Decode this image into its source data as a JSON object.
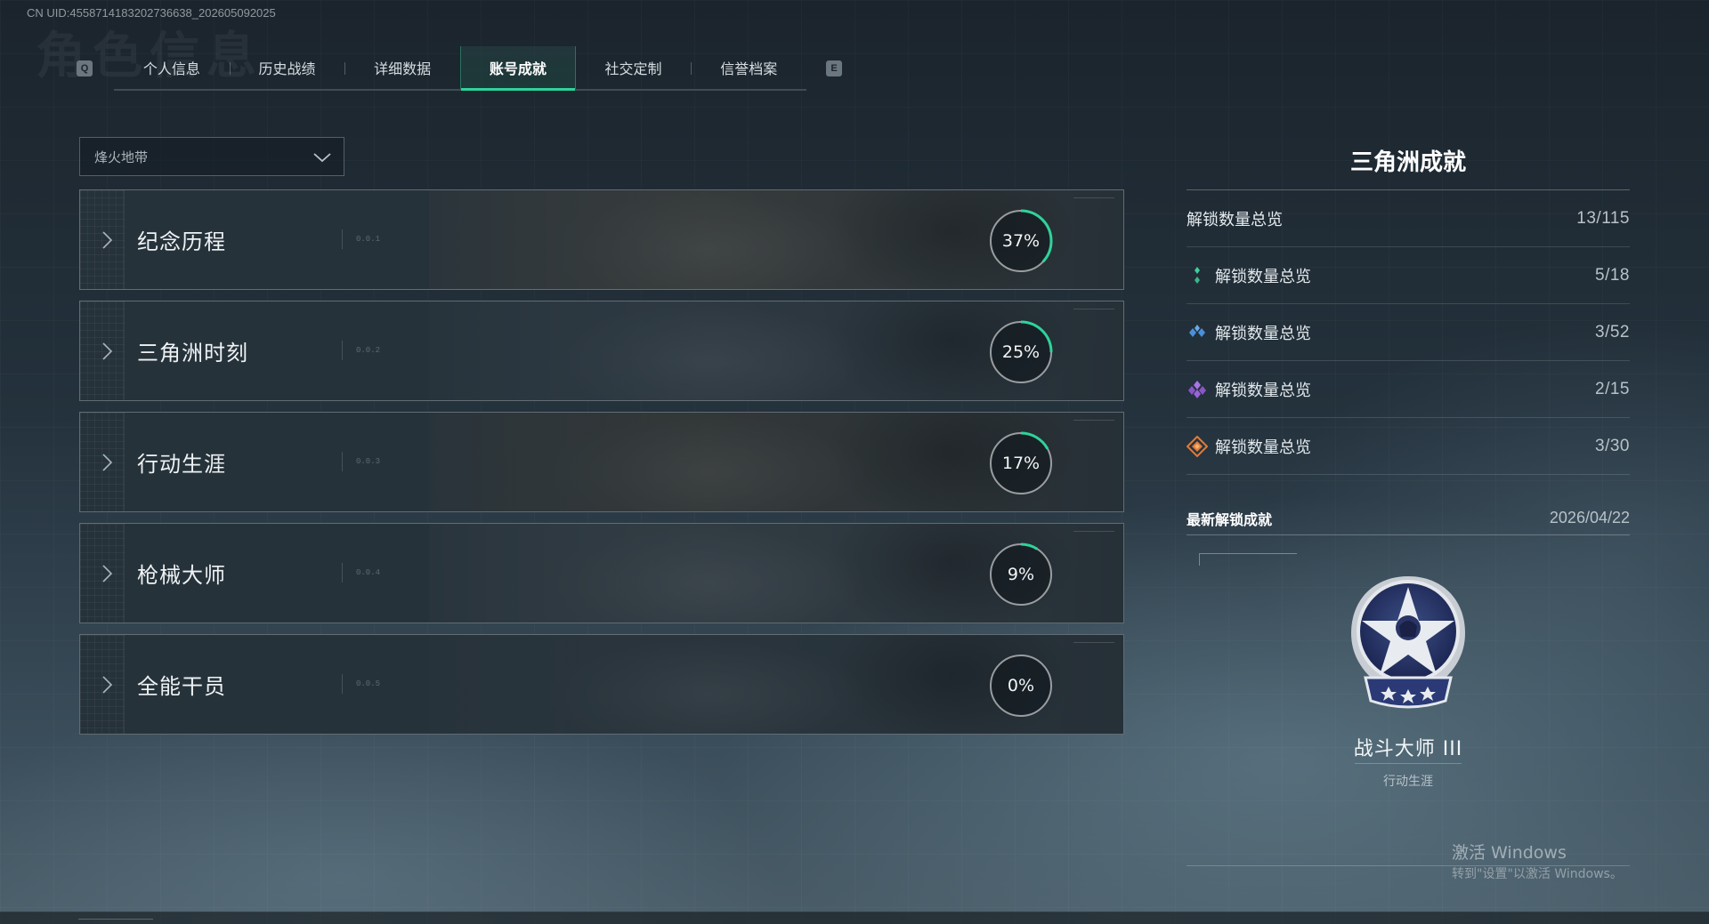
{
  "uid_text": "CN UID:4558714183202736638_202605092025",
  "watermark_title": "角色信息",
  "tabs": {
    "key_left": "Q",
    "key_right": "E",
    "items": [
      {
        "label": "个人信息",
        "active": false
      },
      {
        "label": "历史战绩",
        "active": false
      },
      {
        "label": "详细数据",
        "active": false
      },
      {
        "label": "账号成就",
        "active": true
      },
      {
        "label": "社交定制",
        "active": false
      },
      {
        "label": "信誉档案",
        "active": false
      }
    ]
  },
  "mode_select": {
    "value": "烽火地带"
  },
  "categories": [
    {
      "name": "纪念历程",
      "code": "0.0.1",
      "percent": 37,
      "percent_label": "37%",
      "art_color": "#5a5040"
    },
    {
      "name": "三角洲时刻",
      "code": "0.0.2",
      "percent": 25,
      "percent_label": "25%",
      "art_color": "#3e4a55"
    },
    {
      "name": "行动生涯",
      "code": "0.0.3",
      "percent": 17,
      "percent_label": "17%",
      "art_color": "#4e4536"
    },
    {
      "name": "枪械大师",
      "code": "0.0.4",
      "percent": 9,
      "percent_label": "9%",
      "art_color": "#4a5258"
    },
    {
      "name": "全能干员",
      "code": "0.0.5",
      "percent": 0,
      "percent_label": "0%",
      "art_color": "#323c44"
    }
  ],
  "panel": {
    "title": "三角洲成就",
    "total": {
      "label": "解锁数量总览",
      "value": "13/115"
    },
    "tiers": [
      {
        "label": "解锁数量总览",
        "value": "5/18",
        "icon": "green-tier-icon",
        "color": "#3ecf9a"
      },
      {
        "label": "解锁数量总览",
        "value": "3/52",
        "icon": "blue-tier-icon",
        "color": "#4a90d9"
      },
      {
        "label": "解锁数量总览",
        "value": "2/15",
        "icon": "purple-tier-icon",
        "color": "#9a63d6"
      },
      {
        "label": "解锁数量总览",
        "value": "3/30",
        "icon": "orange-tier-icon",
        "color": "#e07b3a"
      }
    ],
    "recent": {
      "heading": "最新解锁成就",
      "date": "2026/04/22",
      "achievement_name": "战斗大师 III",
      "achievement_category": "行动生涯",
      "badge_icon": "combat-master-badge-icon"
    }
  },
  "windows_notice": {
    "title": "激活 Windows",
    "subtitle": "转到\"设置\"以激活 Windows。"
  },
  "colors": {
    "accent": "#2fd39a"
  }
}
